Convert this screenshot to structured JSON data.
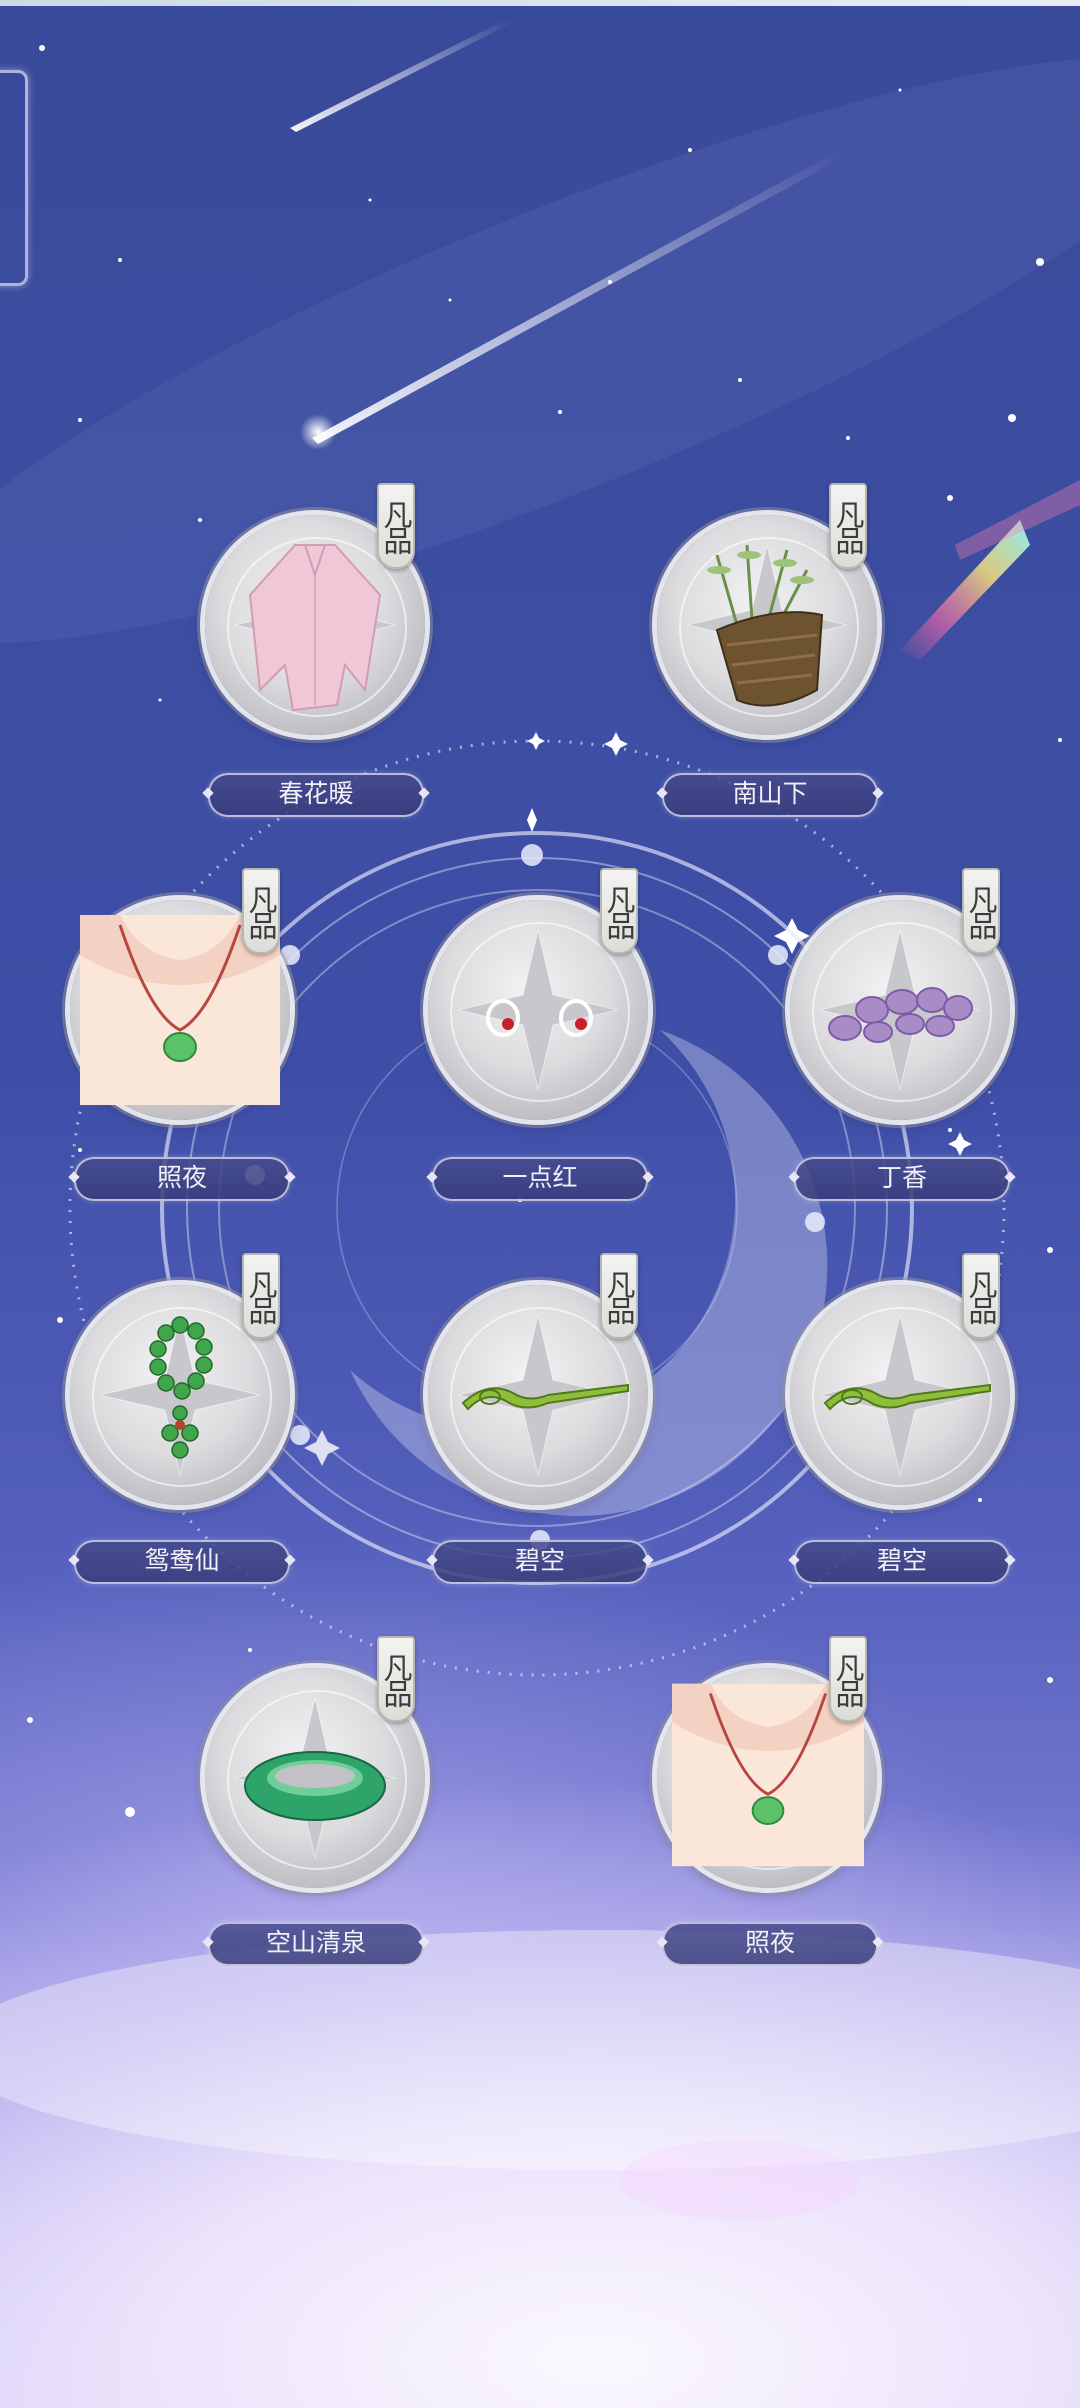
{
  "badge_text": "凡品",
  "items": [
    {
      "name": "春花暖",
      "badge": "凡品",
      "icon": "pink-robe-icon"
    },
    {
      "name": "南山下",
      "badge": "凡品",
      "icon": "bamboo-basket-icon"
    },
    {
      "name": "照夜",
      "badge": "凡品",
      "icon": "jade-necklace-icon"
    },
    {
      "name": "一点红",
      "badge": "凡品",
      "icon": "red-earrings-icon"
    },
    {
      "name": "丁香",
      "badge": "凡品",
      "icon": "amethyst-bracelet-icon"
    },
    {
      "name": "鸳鸯仙",
      "badge": "凡品",
      "icon": "green-beads-icon"
    },
    {
      "name": "碧空",
      "badge": "凡品",
      "icon": "jade-hairpin-icon"
    },
    {
      "name": "碧空",
      "badge": "凡品",
      "icon": "jade-hairpin-icon"
    },
    {
      "name": "空山清泉",
      "badge": "凡品",
      "icon": "jade-bangle-icon"
    },
    {
      "name": "照夜",
      "badge": "凡品",
      "icon": "jade-necklace-icon"
    }
  ],
  "colors": {
    "sky_top": "#3a4a9a",
    "sky_bottom": "#f6f3ff",
    "label_bg": "#464b8c",
    "badge_bg": "#f3f3f1"
  }
}
